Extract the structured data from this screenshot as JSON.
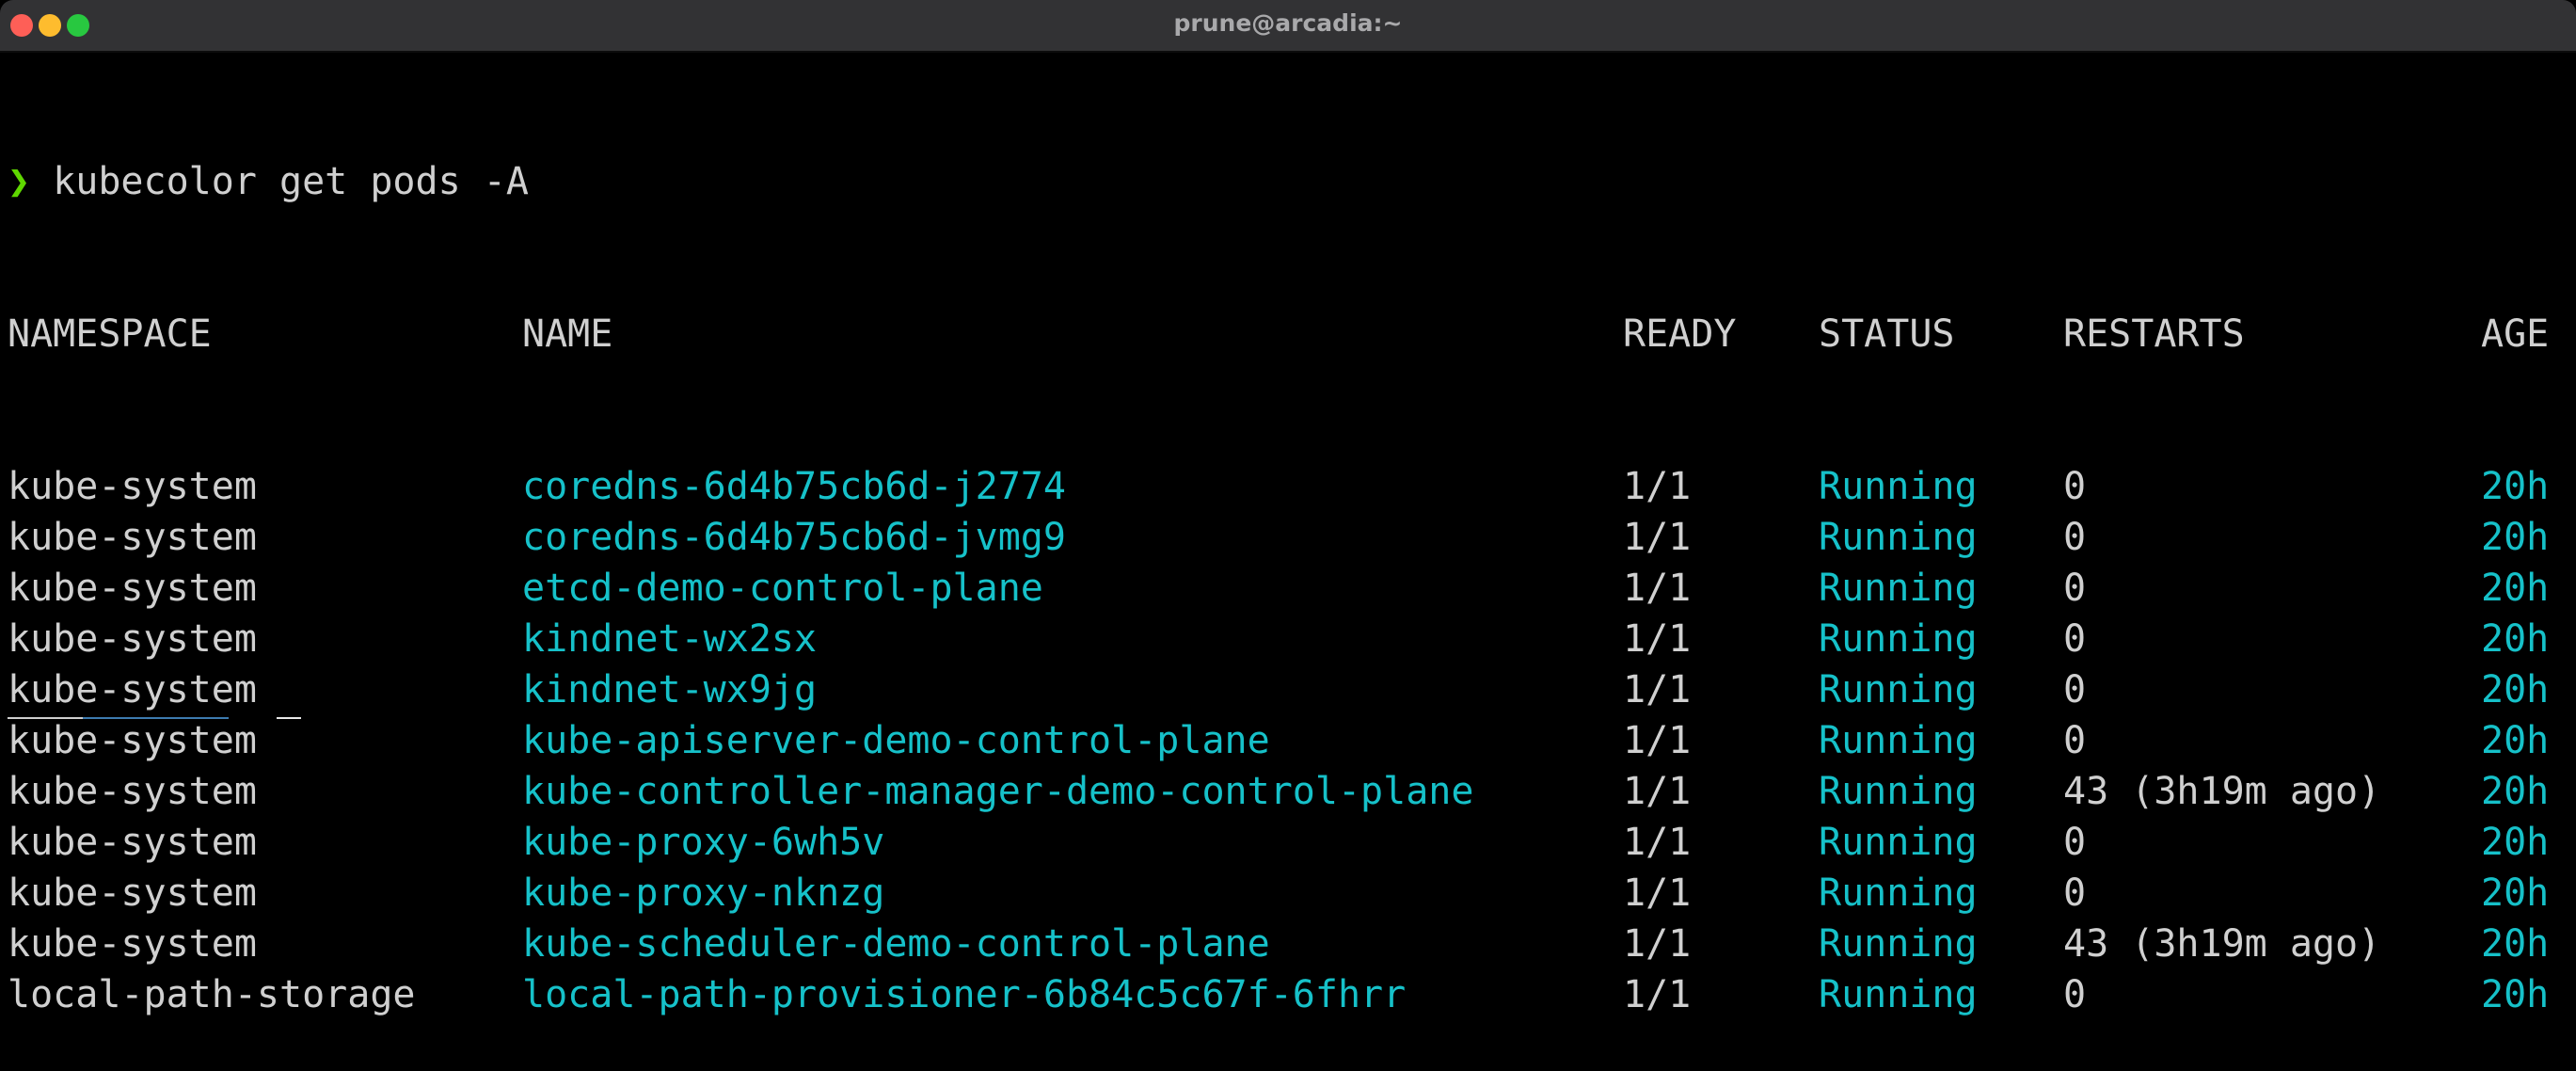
{
  "window": {
    "title": "prune@arcadia:~",
    "controls": [
      "close",
      "minimize",
      "zoom"
    ]
  },
  "terminal": {
    "prompt_symbol": "❯",
    "command": "kubecolor get pods -A",
    "colors": {
      "prompt": "#5fd700",
      "header": "#d0d0d0",
      "cyan": "#16c1c9",
      "text": "#d0d0d0"
    },
    "headers": {
      "namespace": "NAMESPACE",
      "name": "NAME",
      "ready": "READY",
      "status": "STATUS",
      "restarts": "RESTARTS",
      "age": "AGE"
    },
    "rows": [
      {
        "namespace": "kube-system",
        "name": "coredns-6d4b75cb6d-j2774",
        "ready": "1/1",
        "status": "Running",
        "restarts": "0",
        "age": "20h"
      },
      {
        "namespace": "kube-system",
        "name": "coredns-6d4b75cb6d-jvmg9",
        "ready": "1/1",
        "status": "Running",
        "restarts": "0",
        "age": "20h"
      },
      {
        "namespace": "kube-system",
        "name": "etcd-demo-control-plane",
        "ready": "1/1",
        "status": "Running",
        "restarts": "0",
        "age": "20h"
      },
      {
        "namespace": "kube-system",
        "name": "kindnet-wx2sx",
        "ready": "1/1",
        "status": "Running",
        "restarts": "0",
        "age": "20h"
      },
      {
        "namespace": "kube-system",
        "name": "kindnet-wx9jg",
        "ready": "1/1",
        "status": "Running",
        "restarts": "0",
        "age": "20h"
      },
      {
        "namespace": "kube-system",
        "name": "kube-apiserver-demo-control-plane",
        "ready": "1/1",
        "status": "Running",
        "restarts": "0",
        "age": "20h"
      },
      {
        "namespace": "kube-system",
        "name": "kube-controller-manager-demo-control-plane",
        "ready": "1/1",
        "status": "Running",
        "restarts": "43 (3h19m ago)",
        "age": "20h"
      },
      {
        "namespace": "kube-system",
        "name": "kube-proxy-6wh5v",
        "ready": "1/1",
        "status": "Running",
        "restarts": "0",
        "age": "20h"
      },
      {
        "namespace": "kube-system",
        "name": "kube-proxy-nknzg",
        "ready": "1/1",
        "status": "Running",
        "restarts": "0",
        "age": "20h"
      },
      {
        "namespace": "kube-system",
        "name": "kube-scheduler-demo-control-plane",
        "ready": "1/1",
        "status": "Running",
        "restarts": "43 (3h19m ago)",
        "age": "20h"
      },
      {
        "namespace": "local-path-storage",
        "name": "local-path-provisioner-6b84c5c67f-6fhrr",
        "ready": "1/1",
        "status": "Running",
        "restarts": "0",
        "age": "20h"
      }
    ]
  }
}
